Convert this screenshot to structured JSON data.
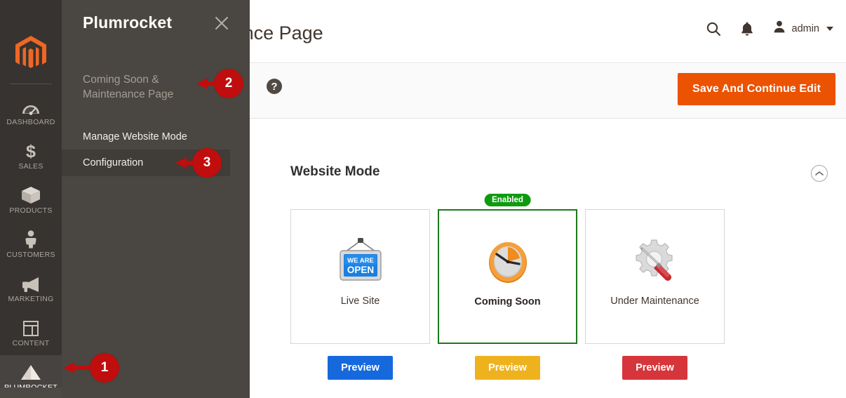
{
  "admin_rail": {
    "logo_icon": "magento-logo-icon",
    "items": [
      {
        "label": "DASHBOARD",
        "icon": "dashboard-gauge-icon",
        "active": false
      },
      {
        "label": "SALES",
        "icon": "dollar-sign-icon",
        "active": false
      },
      {
        "label": "PRODUCTS",
        "icon": "box-package-icon",
        "active": false
      },
      {
        "label": "CUSTOMERS",
        "icon": "person-icon",
        "active": false
      },
      {
        "label": "MARKETING",
        "icon": "megaphone-icon",
        "active": false
      },
      {
        "label": "CONTENT",
        "icon": "layout-page-icon",
        "active": false
      },
      {
        "label": "PLUMROCKET",
        "icon": "plumrocket-pyramid-icon",
        "active": true
      }
    ]
  },
  "flyout": {
    "title": "Plumrocket",
    "close_icon": "close-x-icon",
    "section_label": "Coming Soon & Maintenance Page",
    "links": [
      {
        "label": "Manage Website Mode",
        "selected": false
      },
      {
        "label": "Configuration",
        "selected": true
      }
    ]
  },
  "header": {
    "page_title": "aintenance Page",
    "search_icon": "search-icon",
    "notifications_icon": "bell-icon",
    "user_icon": "user-avatar-icon",
    "user_name": "admin",
    "caret_icon": "chevron-down-icon"
  },
  "action_bar": {
    "help_icon": "question-mark-help-icon",
    "help_glyph": "?",
    "save_label": "Save And Continue Edit",
    "save_color": "#eb5202"
  },
  "section": {
    "title": "Website Mode",
    "collapse_icon": "chevron-up-circle-icon",
    "modes": [
      {
        "label": "Live Site",
        "icon": "we-are-open-sign-icon",
        "icon_text_line1": "WE ARE",
        "icon_text_line2": "OPEN",
        "selected": false,
        "badge": "",
        "preview_label": "Preview",
        "preview_color": "#1669dd"
      },
      {
        "label": "Coming Soon",
        "icon": "orange-clock-icon",
        "selected": true,
        "badge": "Enabled",
        "badge_color": "#0f9b0f",
        "preview_label": "Preview",
        "preview_color": "#efb21f"
      },
      {
        "label": "Under Maintenance",
        "icon": "gear-screwdriver-icon",
        "selected": false,
        "badge": "",
        "preview_label": "Preview",
        "preview_color": "#d6353b"
      }
    ]
  },
  "callouts": [
    {
      "number": "1",
      "target": "sidebar-item-plumrocket"
    },
    {
      "number": "2",
      "target": "flyout-section-label"
    },
    {
      "number": "3",
      "target": "flyout-link-configuration"
    }
  ],
  "colors": {
    "rail_bg": "#373330",
    "flyout_bg": "#4a4641",
    "callout_red": "#c00d0d",
    "selected_green": "#1a7a1a"
  }
}
